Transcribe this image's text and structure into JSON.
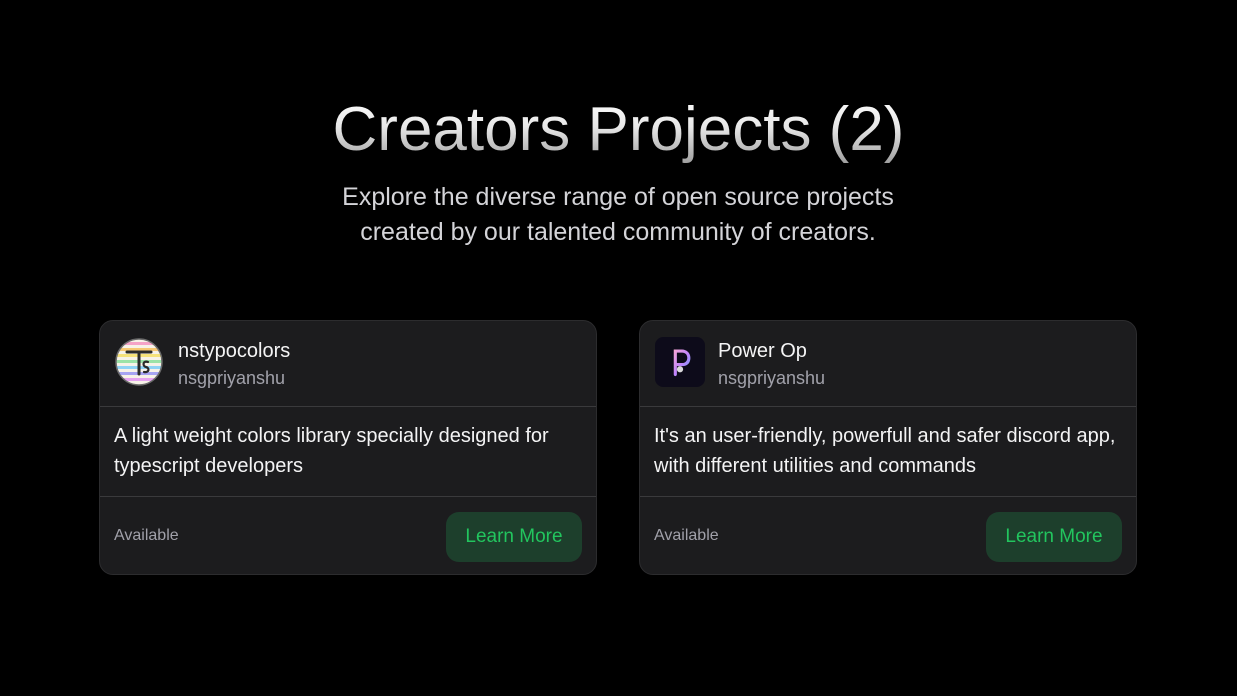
{
  "header": {
    "title": "Creators Projects (2)",
    "subtitle": "Explore the diverse range of open source projects created by our talented community of creators."
  },
  "projects": [
    {
      "name": "nstypocolors",
      "author": "nsgpriyanshu",
      "description": "A light weight colors library specially designed for typescript developers",
      "status": "Available",
      "button_label": "Learn More",
      "icon": "ts-rainbow-logo-icon"
    },
    {
      "name": "Power Op",
      "author": "nsgpriyanshu",
      "description": "It's an user-friendly, powerfull and safer discord app, with different utilities and commands",
      "status": "Available",
      "button_label": "Learn More",
      "icon": "power-op-logo-icon"
    }
  ],
  "colors": {
    "background": "#000000",
    "card_background": "#1c1c1e",
    "accent_green": "#22c55e",
    "button_background": "#1d3f2c"
  }
}
